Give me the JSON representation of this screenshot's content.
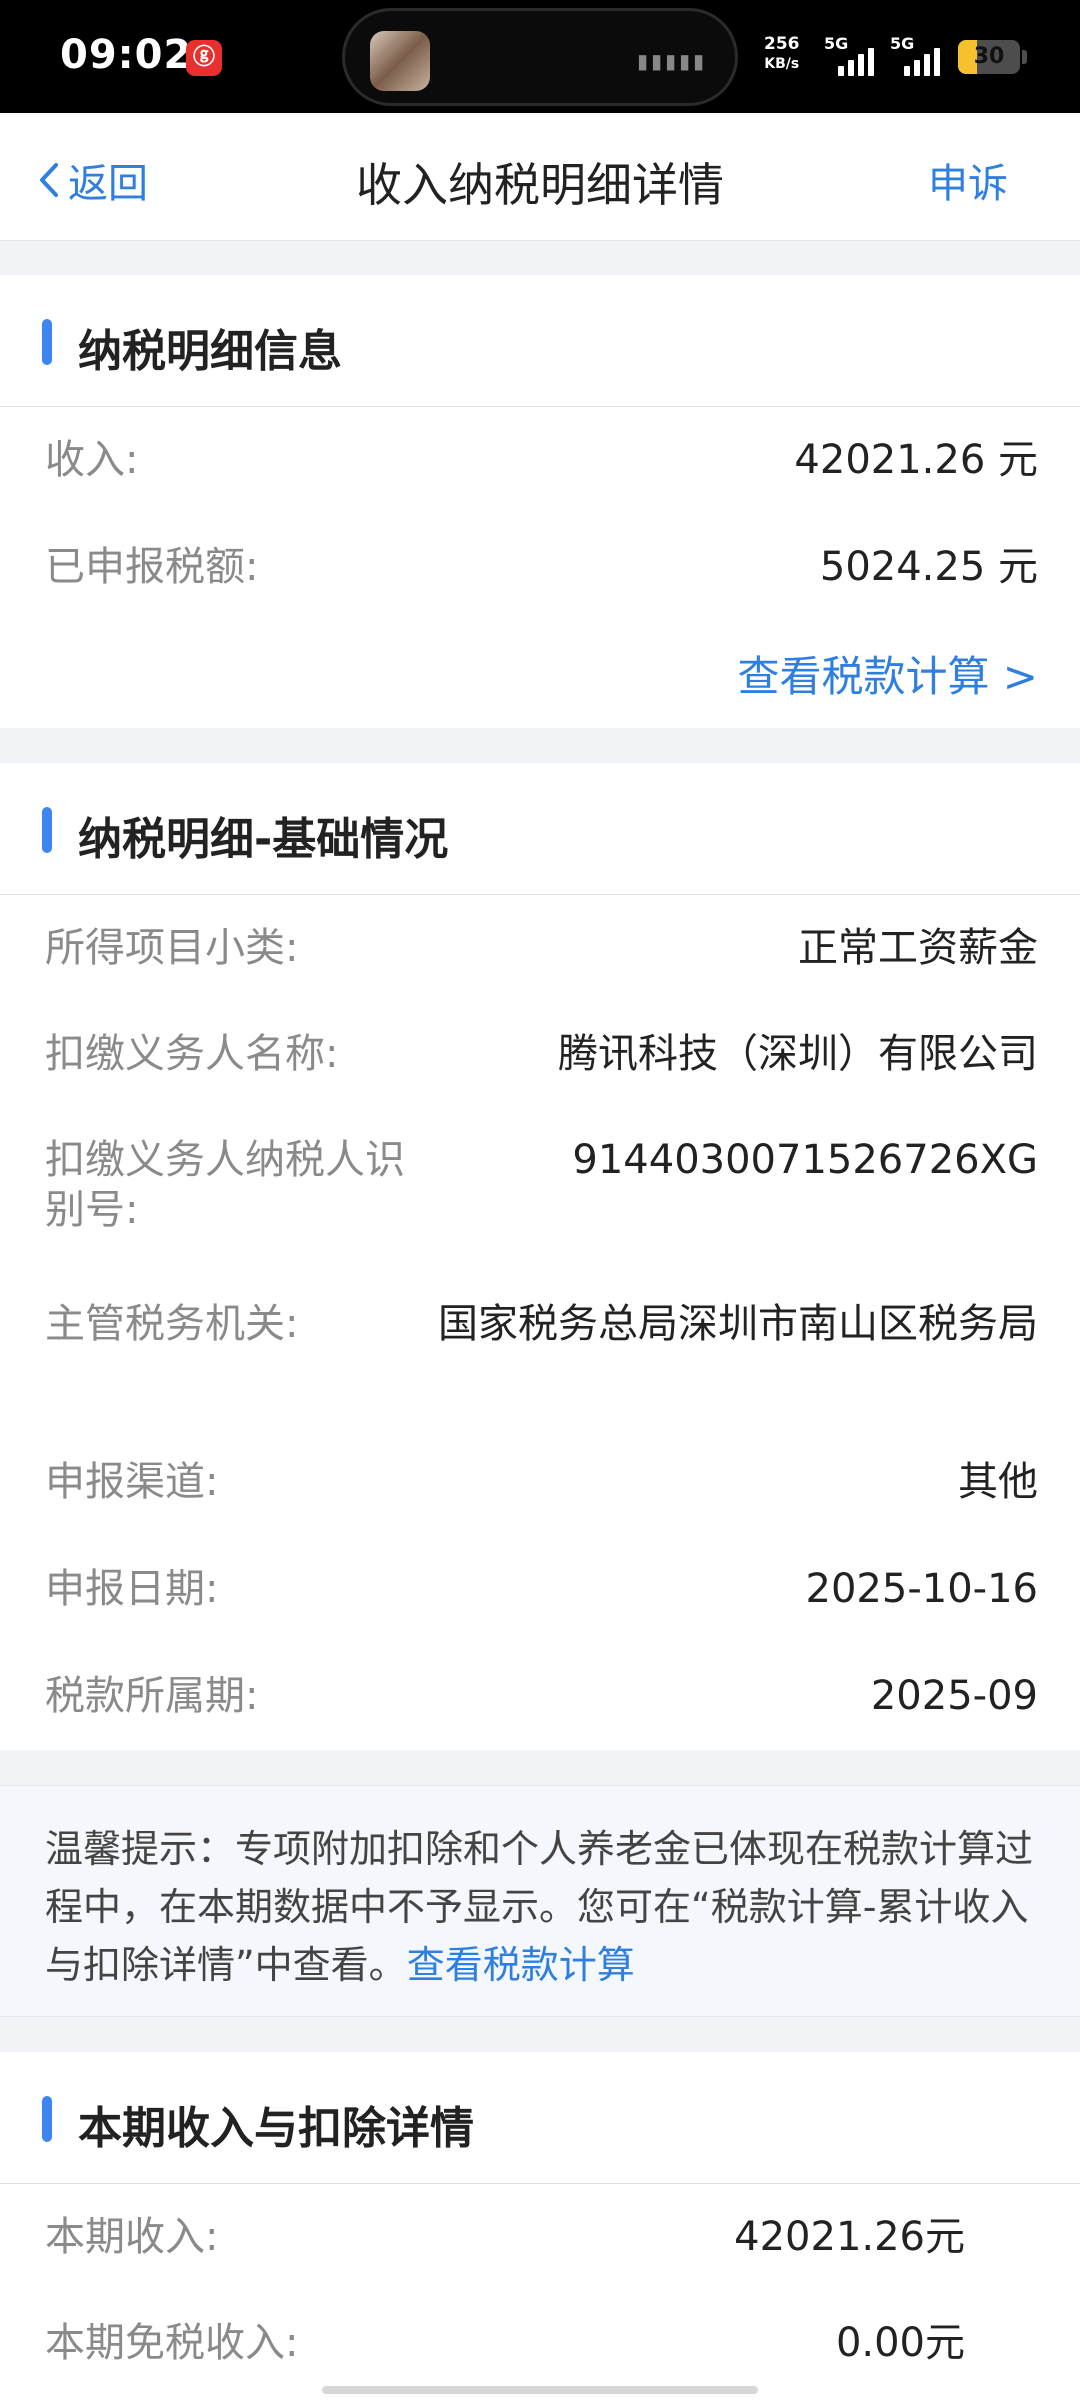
{
  "status_bar": {
    "time": "09:02",
    "net_speed_value": "256",
    "net_speed_unit": "KB/s",
    "sim1": "5G",
    "sim2": "5G",
    "battery": "30",
    "battery_level": 0.3
  },
  "nav": {
    "back": "返回",
    "title": "收入纳税明细详情",
    "appeal": "申诉"
  },
  "section1": {
    "title": "纳税明细信息",
    "income_label": "收入:",
    "income_value": "42021.26 元",
    "tax_label": "已申报税额:",
    "tax_value": "5024.25 元",
    "link": "查看税款计算 >"
  },
  "section2": {
    "title": "纳税明细-基础情况",
    "rows": [
      {
        "label": "所得项目小类:",
        "value": "正常工资薪金"
      },
      {
        "label": "扣缴义务人名称:",
        "value": "腾讯科技（深圳）有限公司"
      },
      {
        "label": "扣缴义务人纳税人识别号:",
        "value": "9144030071526726XG"
      },
      {
        "label": "主管税务机关:",
        "value": "国家税务总局深圳市南山区税务局"
      },
      {
        "label": "申报渠道:",
        "value": "其他"
      },
      {
        "label": "申报日期:",
        "value": "2025-10-16"
      },
      {
        "label": "税款所属期:",
        "value": "2025-09"
      }
    ]
  },
  "tip": {
    "text": "温馨提示：专项附加扣除和个人养老金已体现在税款计算过程中，在本期数据中不予显示。您可在“税款计算-累计收入与扣除详情”中查看。",
    "link": "查看税款计算"
  },
  "section3": {
    "title": "本期收入与扣除详情",
    "rows": [
      {
        "label": "本期收入:",
        "value": "42021.26元"
      },
      {
        "label": "本期免税收入:",
        "value": "0.00元"
      }
    ]
  }
}
